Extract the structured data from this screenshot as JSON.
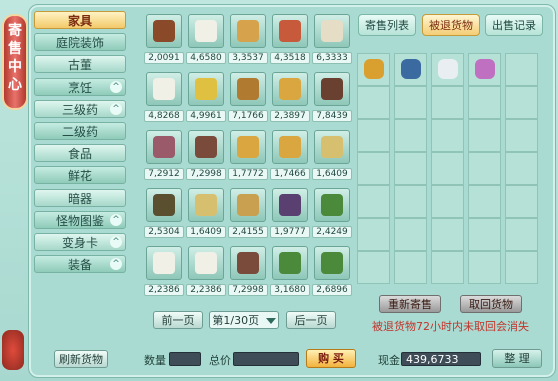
{
  "title_chars": [
    "寄",
    "售",
    "中",
    "心"
  ],
  "categories": [
    {
      "label": "家具",
      "selected": true,
      "arrow": false
    },
    {
      "label": "庭院装饰",
      "selected": false,
      "arrow": false
    },
    {
      "label": "古董",
      "selected": false,
      "arrow": false
    },
    {
      "label": "烹饪",
      "selected": false,
      "arrow": true
    },
    {
      "label": "三级药",
      "selected": false,
      "arrow": true
    },
    {
      "label": "二级药",
      "selected": false,
      "arrow": false
    },
    {
      "label": "食品",
      "selected": false,
      "arrow": false
    },
    {
      "label": "鲜花",
      "selected": false,
      "arrow": false
    },
    {
      "label": "暗器",
      "selected": false,
      "arrow": false
    },
    {
      "label": "怪物图鉴",
      "selected": false,
      "arrow": true
    },
    {
      "label": "变身卡",
      "selected": false,
      "arrow": true
    },
    {
      "label": "装备",
      "selected": false,
      "arrow": true
    }
  ],
  "arrow_glyph": "^",
  "items": [
    {
      "icon": "folding-screen-icon",
      "count": "2,0091",
      "color": "#8a4a2a"
    },
    {
      "icon": "white-flower-pot-icon",
      "count": "4,6580",
      "color": "#f0f0e6"
    },
    {
      "icon": "wooden-table-icon",
      "count": "3,3537",
      "color": "#d7a24c"
    },
    {
      "icon": "red-flower-pot-icon",
      "count": "4,3518",
      "color": "#c65a3a"
    },
    {
      "icon": "vase-icon",
      "count": "6,3333",
      "color": "#e5ddc6"
    },
    {
      "icon": "white-flower-pot-icon",
      "count": "4,8268",
      "color": "#f0f0e6"
    },
    {
      "icon": "yellow-flower-pot-icon",
      "count": "4,9961",
      "color": "#e0c040"
    },
    {
      "icon": "bronze-vase-icon",
      "count": "7,1766",
      "color": "#b07a30"
    },
    {
      "icon": "golden-ornament-icon",
      "count": "2,3897",
      "color": "#d9a640"
    },
    {
      "icon": "weapon-rack-icon",
      "count": "7,8439",
      "color": "#6a4030"
    },
    {
      "icon": "curtain-stand-icon",
      "count": "7,2912",
      "color": "#9a5a6a"
    },
    {
      "icon": "screen-panel-icon",
      "count": "7,2998",
      "color": "#7a4a3a"
    },
    {
      "icon": "golden-ornament-icon",
      "count": "1,7772",
      "color": "#d9a640"
    },
    {
      "icon": "golden-ornament-icon",
      "count": "1,7466",
      "color": "#d9a640"
    },
    {
      "icon": "square-table-icon",
      "count": "1,6409",
      "color": "#d6c070"
    },
    {
      "icon": "bronze-vase-icon",
      "count": "2,5304",
      "color": "#5a5030"
    },
    {
      "icon": "square-table-icon",
      "count": "1,6409",
      "color": "#d6c070"
    },
    {
      "icon": "stool-icon",
      "count": "2,4155",
      "color": "#c8a050"
    },
    {
      "icon": "curtain-stand-icon",
      "count": "1,9777",
      "color": "#5a4070"
    },
    {
      "icon": "green-plant-pot-icon",
      "count": "2,4249",
      "color": "#4a8a3a"
    },
    {
      "icon": "white-flower-pot-icon",
      "count": "2,2386",
      "color": "#f0f0e6"
    },
    {
      "icon": "white-flower-pot-icon",
      "count": "2,2386",
      "color": "#f0f0e6"
    },
    {
      "icon": "screen-panel-icon",
      "count": "7,2998",
      "color": "#7a4a3a"
    },
    {
      "icon": "green-plant-pot-icon",
      "count": "3,1680",
      "color": "#4a8a3a"
    },
    {
      "icon": "green-plant-pot-icon",
      "count": "2,6896",
      "color": "#4a8a3a"
    }
  ],
  "tabs": [
    {
      "label": "寄售列表",
      "active": false
    },
    {
      "label": "被退货物",
      "active": true
    },
    {
      "label": "出售记录",
      "active": false
    }
  ],
  "returned_items": [
    {
      "icon": "gourd-icon",
      "color": "#d9a030"
    },
    {
      "icon": "blue-jar-icon",
      "color": "#3a6aa0"
    },
    {
      "icon": "blue-vase-icon",
      "color": "#e8eef2"
    },
    {
      "icon": "purple-potion-icon",
      "color": "#c070c0"
    }
  ],
  "buttons": {
    "relist": "重新寄售",
    "retrieve": "取回货物",
    "prev": "前一页",
    "next": "后一页",
    "refresh": "刷新货物",
    "buy": "购 买",
    "organize": "整 理"
  },
  "page_indicator": "第1/30页",
  "notice": "被退货物72小时内未取回会消失",
  "quantity_label": "数量",
  "total_label": "总价",
  "cash_label": "现金",
  "cash_value": "439,6733",
  "quantity_value": "",
  "total_value": ""
}
